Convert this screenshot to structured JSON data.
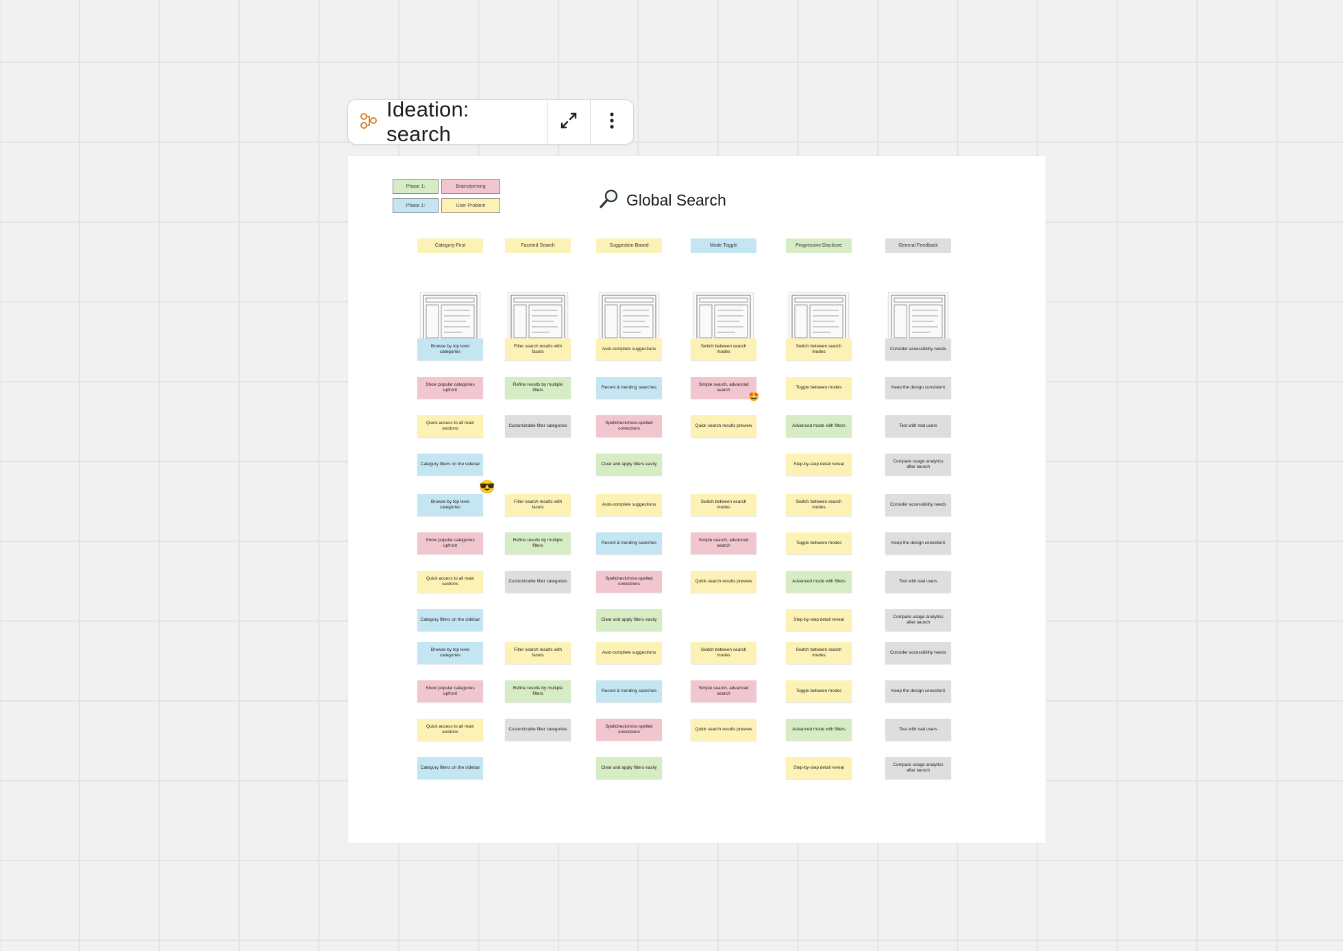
{
  "toolbar": {
    "title": "Ideation: search",
    "icon": "diagram-nodes-icon",
    "expand_icon": "expand-arrows-icon",
    "more_icon": "more-vertical-icon",
    "accent": "#d9822b"
  },
  "board": {
    "title": "Global Search",
    "title_icon": "magnifying-glass-icon"
  },
  "legend": [
    {
      "phase": "Phase 1:",
      "label": "Brainstorming",
      "phase_color": "#d6ecc4",
      "label_color": "#f2c6ce"
    },
    {
      "phase": "Phase 1:",
      "label": "User Problem",
      "phase_color": "#c4e6f2",
      "label_color": "#fdf2b5"
    }
  ],
  "columns": [
    {
      "header": "Category-First",
      "header_color": "yellow"
    },
    {
      "header": "Faceted Search",
      "header_color": "yellow"
    },
    {
      "header": "Suggestion-Based",
      "header_color": "yellow"
    },
    {
      "header": "Mode Toggle",
      "header_color": "blue"
    },
    {
      "header": "Progressive Disclosre",
      "header_color": "green"
    },
    {
      "header": "General Feedback",
      "header_color": "grey"
    }
  ],
  "notes": [
    [
      {
        "text": "Browse by top level categories",
        "color": "blue"
      },
      {
        "text": "Show popular categories upfront",
        "color": "pink"
      },
      {
        "text": "Quick access to all main sections",
        "color": "yellow"
      },
      {
        "text": "Category filters on the sidebar",
        "color": "blue"
      }
    ],
    [
      {
        "text": "Filter search results with facets",
        "color": "yellow"
      },
      {
        "text": "Refine results by multiple filters",
        "color": "green"
      },
      {
        "text": "Customizable filter categories",
        "color": "grey"
      },
      null
    ],
    [
      {
        "text": "Auto-complete suggestions",
        "color": "yellow"
      },
      {
        "text": "Recent & trending searches",
        "color": "blue"
      },
      {
        "text": "Spellcheck/miss-spelled corrections",
        "color": "pink"
      },
      {
        "text": "Clear and apply filters easily",
        "color": "green"
      }
    ],
    [
      {
        "text": "Switch between search modes",
        "color": "yellow"
      },
      {
        "text": "Simple search, advanced search",
        "color": "pink"
      },
      {
        "text": "Quick search results preview",
        "color": "yellow"
      },
      null
    ],
    [
      {
        "text": "Switch between search modes",
        "color": "yellow"
      },
      {
        "text": "Toggle between modes",
        "color": "yellow"
      },
      {
        "text": "Advanced mode with filters",
        "color": "green"
      },
      {
        "text": "Step-by-step detail reveal",
        "color": "yellow"
      }
    ],
    [
      {
        "text": "Consider accessibility needs",
        "color": "grey"
      },
      {
        "text": "Keep the design consistent",
        "color": "grey"
      },
      {
        "text": "Test with real users",
        "color": "grey"
      },
      {
        "text": "Compare usage analytics after launch",
        "color": "grey"
      }
    ]
  ],
  "reactions": [
    {
      "emoji": "😎",
      "name": "sunglasses-emoji"
    },
    {
      "emoji": "🤩",
      "name": "star-struck-emoji"
    }
  ]
}
